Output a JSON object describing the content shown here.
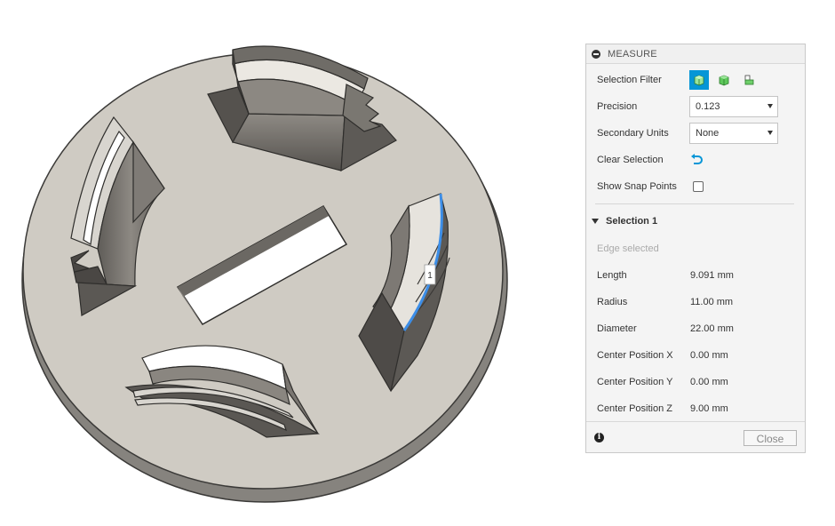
{
  "panel": {
    "title": "MEASURE",
    "selection_filter_label": "Selection Filter",
    "filter_icons": [
      "body-filter-icon",
      "face-filter-icon",
      "edge-filter-icon"
    ],
    "precision_label": "Precision",
    "precision_value": "0.123",
    "secondary_units_label": "Secondary Units",
    "secondary_units_value": "None",
    "clear_selection_label": "Clear Selection",
    "show_snap_points_label": "Show Snap Points",
    "show_snap_points_checked": false,
    "accent_color": "#0696d7"
  },
  "selection": {
    "title": "Selection 1",
    "status": "Edge selected",
    "rows": [
      {
        "label": "Length",
        "value": "9.091 mm"
      },
      {
        "label": "Radius",
        "value": "11.00 mm"
      },
      {
        "label": "Diameter",
        "value": "22.00 mm"
      },
      {
        "label": "Center Position X",
        "value": "0.00 mm"
      },
      {
        "label": "Center Position Y",
        "value": "0.00 mm"
      },
      {
        "label": "Center Position Z",
        "value": "9.00 mm"
      }
    ]
  },
  "footer": {
    "close_label": "Close"
  },
  "viewport": {
    "selection_marker": "1",
    "highlight_color": "#3c8ee8"
  }
}
